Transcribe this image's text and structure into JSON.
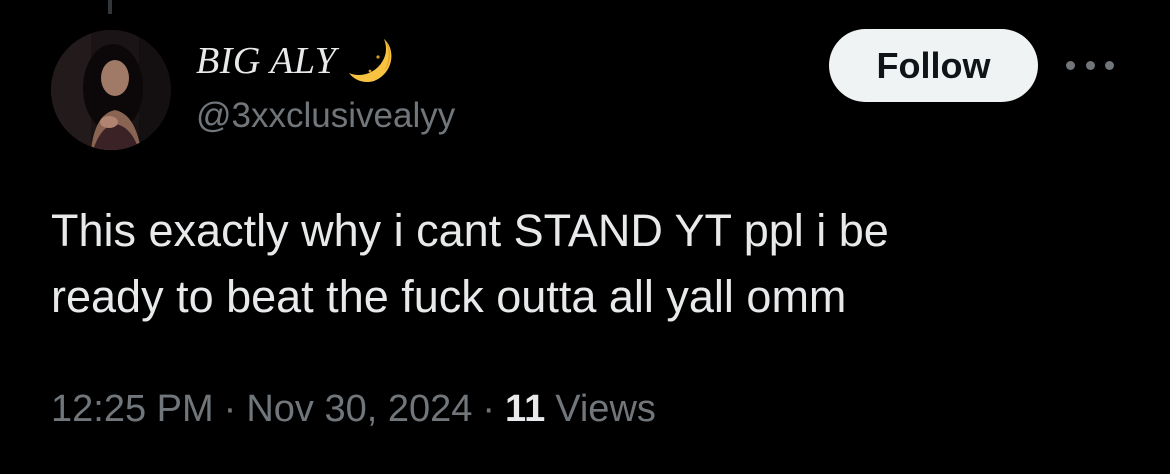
{
  "tweet": {
    "author": {
      "display_name": "BIG ALY",
      "name_emoji": "crescent-moon-icon",
      "handle": "@3xxclusivealyy"
    },
    "follow_label": "Follow",
    "more_icon": "more-options-icon",
    "text_line_1": "This exactly why i cant STAND YT ppl i be",
    "text_line_2": "ready to beat the fuck outta all yall omm",
    "time": "12:25 PM",
    "separator": "·",
    "date": "Nov 30, 2024",
    "view_count": "11",
    "views_label": "Views"
  },
  "colors": {
    "background": "#000000",
    "primary_text": "#e7e9ea",
    "secondary_text": "#71767b",
    "follow_bg": "#eff3f4",
    "follow_text": "#0f1419",
    "moon": "#f7c341"
  }
}
